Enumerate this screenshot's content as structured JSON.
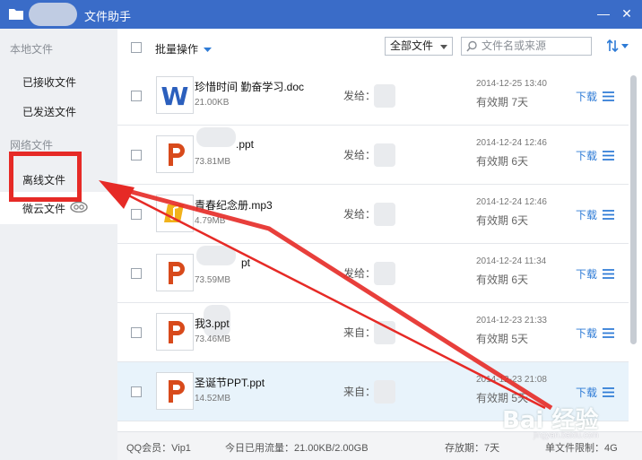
{
  "window": {
    "title": "文件助手",
    "minimize": "—",
    "close": "✕"
  },
  "sidebar": {
    "sections": [
      {
        "label": "本地文件",
        "items": [
          "已接收文件",
          "已发送文件"
        ]
      },
      {
        "label": "网络文件",
        "items": [
          "离线文件",
          "微云文件"
        ]
      }
    ]
  },
  "toolbar": {
    "batch_label": "批量操作",
    "filter_value": "全部文件",
    "search_placeholder": "文件名或来源"
  },
  "files": [
    {
      "name": "珍惜时间 勤奋学习.doc",
      "size": "21.00KB",
      "peer": "发给：",
      "time": "2014-12-25 13:40",
      "expiry": "有效期 7天",
      "type": "word"
    },
    {
      "name": ".ppt",
      "size": "73.81MB",
      "peer": "发给：",
      "time": "2014-12-24 12:46",
      "expiry": "有效期 6天",
      "type": "ppt"
    },
    {
      "name": "青春纪念册.mp3",
      "size": "4.79MB",
      "peer": "发给：",
      "time": "2014-12-24 12:46",
      "expiry": "有效期 6天",
      "type": "audio"
    },
    {
      "name": "pt",
      "size": "73.59MB",
      "peer": "发给：",
      "time": "2014-12-24 11:34",
      "expiry": "有效期 6天",
      "type": "ppt"
    },
    {
      "name": "我3.ppt",
      "size": "73.46MB",
      "peer": "来自：",
      "time": "2014-12-23 21:33",
      "expiry": "有效期 5天",
      "type": "ppt"
    },
    {
      "name": "圣诞节PPT.ppt",
      "size": "14.52MB",
      "peer": "来自：",
      "time": "2014-12-23 21:08",
      "expiry": "有效期 5天",
      "type": "ppt"
    }
  ],
  "download_label": "下载",
  "status": {
    "member": "QQ会员：Vip1",
    "traffic": "今日已用流量：21.00KB/2.00GB",
    "retention": "存放期：7天",
    "limit": "单文件限制：4G"
  },
  "watermark": {
    "logo": "Bai 经验",
    "url": "jingyan.baidu.com"
  },
  "colors": {
    "titlebar": "#3a6cc8",
    "link": "#2e7bd6",
    "annotation": "#e62a26",
    "word": "#2b5fbd",
    "ppt": "#d84a1b",
    "audio": "#f1b21a"
  }
}
